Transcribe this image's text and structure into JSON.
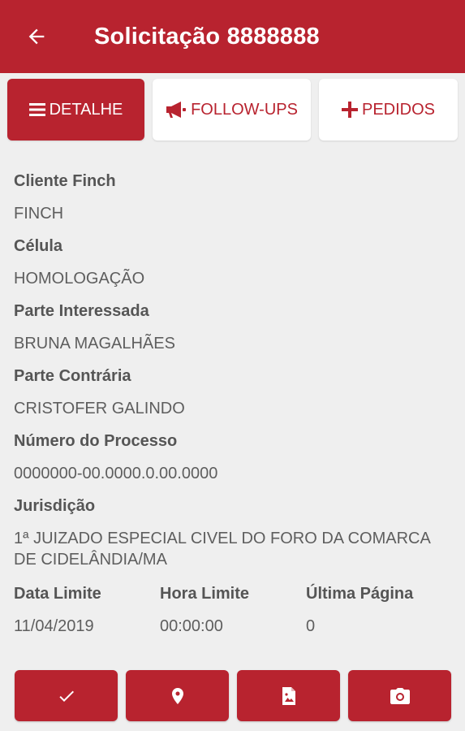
{
  "appbar": {
    "title": "Solicitação 8888888"
  },
  "tabs": [
    {
      "label": "DETALHE"
    },
    {
      "label": "FOLLOW-UPS"
    },
    {
      "label": "PEDIDOS"
    }
  ],
  "details": {
    "cliente_label": "Cliente Finch",
    "cliente_value": "FINCH",
    "celula_label": "Célula",
    "celula_value": "HOMOLOGAÇÃO",
    "parte_interessada_label": "Parte Interessada",
    "parte_interessada_value": "BRUNA MAGALHÃES",
    "parte_contraria_label": "Parte Contrária",
    "parte_contraria_value": "CRISTOFER GALINDO",
    "numero_processo_label": "Número do Processo",
    "numero_processo_value": "0000000-00.0000.0.00.0000",
    "jurisdicao_label": "Jurisdição",
    "jurisdicao_value": "1ª JUIZADO ESPECIAL CIVEL DO FORO DA COMARCA DE CIDELÂNDIA/MA",
    "data_limite_label": "Data Limite",
    "data_limite_value": "11/04/2019",
    "hora_limite_label": "Hora Limite",
    "hora_limite_value": "00:00:00",
    "ultima_pagina_label": "Última Página",
    "ultima_pagina_value": "0"
  },
  "colors": {
    "primary": "#b8232f",
    "background": "#efefef",
    "label": "#555555",
    "value": "#5e5e5e"
  },
  "icons": {
    "back": "arrow-back-icon",
    "detalhe": "menu-lines-icon",
    "followups": "megaphone-icon",
    "pedidos": "plus-icon",
    "action1": "checkmark-icon",
    "action2": "location-pin-icon",
    "action3": "image-file-icon",
    "action4": "camera-icon"
  }
}
